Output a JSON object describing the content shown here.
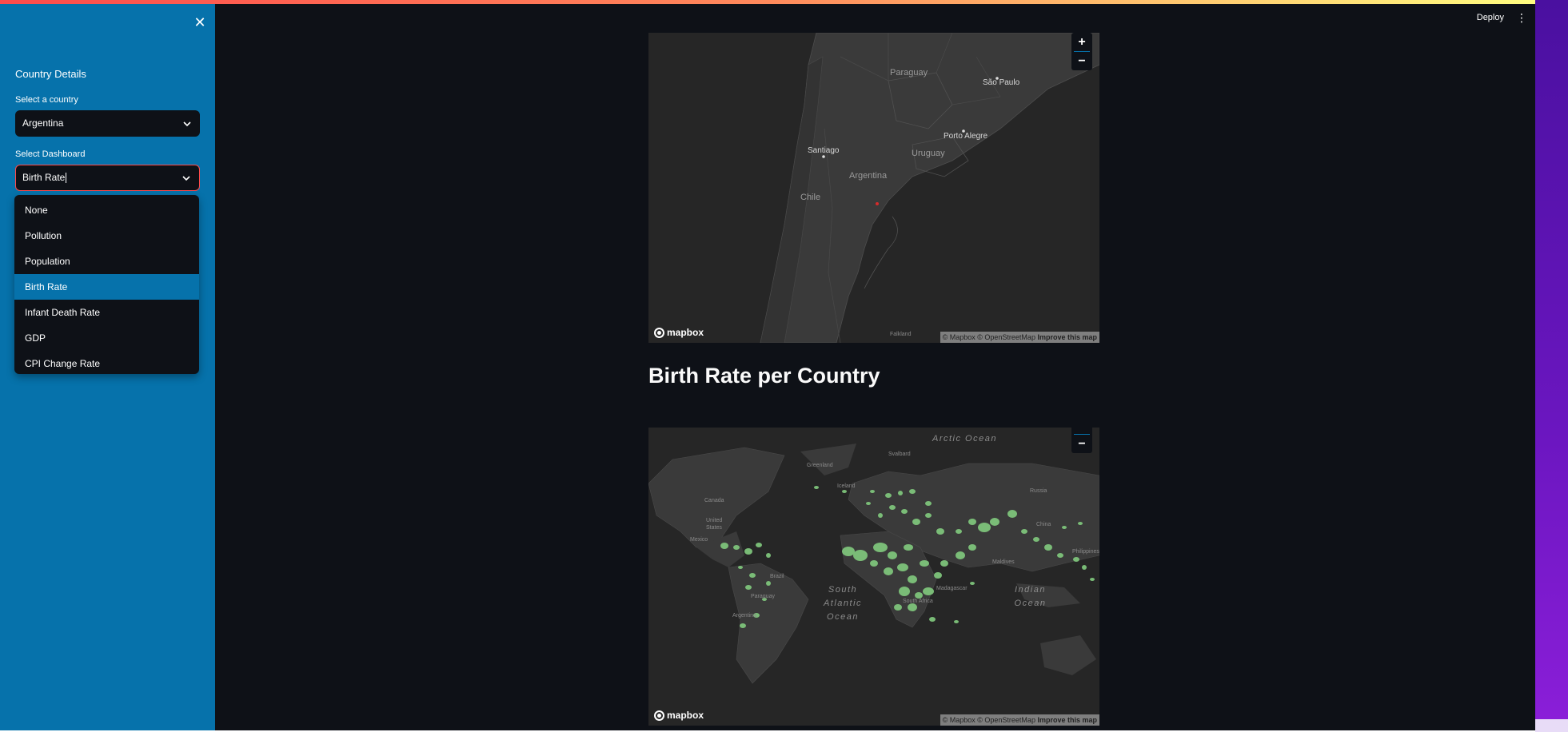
{
  "sidebar": {
    "title": "Country Details",
    "country_label": "Select a country",
    "country_value": "Argentina",
    "dashboard_label": "Select Dashboard",
    "dashboard_value": "Birth Rate",
    "dashboard_options": [
      "None",
      "Pollution",
      "Population",
      "Birth Rate",
      "Infant Death Rate",
      "GDP",
      "CPI Change Rate"
    ],
    "close_icon": "close-icon"
  },
  "header": {
    "deploy_label": "Deploy",
    "menu_icon": "more-vertical-icon"
  },
  "map_top": {
    "labels": {
      "paraguay": "Paraguay",
      "sao_paulo": "São Paulo",
      "porto_alegre": "Porto Alegre",
      "santiago": "Santiago",
      "uruguay": "Uruguay",
      "argentina": "Argentina",
      "chile": "Chile",
      "falkland": "Falkland"
    },
    "marker_color": "#d62b2b",
    "zoom_in": "+",
    "zoom_out": "−",
    "logo": "mapbox",
    "attribution": "© Mapbox © OpenStreetMap",
    "improve": "Improve this map"
  },
  "section_title": "Birth Rate per Country",
  "map_bottom": {
    "labels": {
      "arctic_ocean": "Arctic Ocean",
      "greenland": "Greenland",
      "svalbard": "Svalbard",
      "iceland": "Iceland",
      "canada": "Canada",
      "united_states": "United States",
      "mexico": "Mexico",
      "russia": "Russia",
      "china": "China",
      "brazil": "Brazil",
      "paraguay": "Paraguay",
      "argentina": "Argentina",
      "south_atlantic": "South Atlantic Ocean",
      "indian_ocean": "Indian Ocean",
      "maldives": "Maldives",
      "madagascar": "Madagascar",
      "south_africa": "South Africa",
      "philippines": "Philippines"
    },
    "bubble_color": "#7ec47b",
    "zoom_in": "+",
    "zoom_out": "−",
    "logo": "mapbox",
    "attribution": "© Mapbox © OpenStreetMap",
    "improve": "Improve this map"
  }
}
